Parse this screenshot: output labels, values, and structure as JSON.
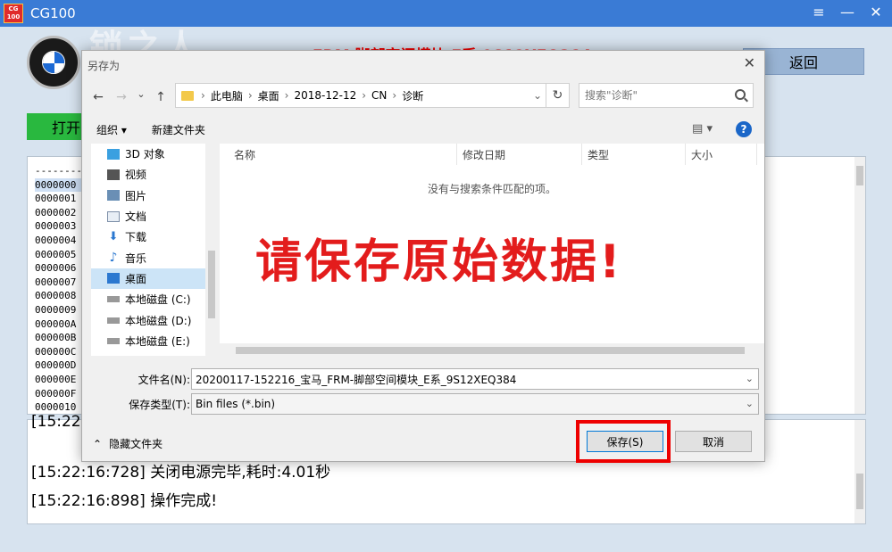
{
  "app": {
    "title": "CG100",
    "logo_text_top": "CG",
    "logo_text_bottom": "100",
    "window_controls": [
      "≡",
      "—",
      "✕"
    ],
    "watermark": "锁之人",
    "header_red_text": "FRM 脚部空间模块 E系 9S12XEQ384",
    "back_label": "返回",
    "open_label": "打开"
  },
  "hex_list": {
    "top_dashes": "--------",
    "rows": [
      "0000000",
      "0000001",
      "0000002",
      "0000003",
      "0000004",
      "0000005",
      "0000006",
      "0000007",
      "0000008",
      "0000009",
      "000000A",
      "000000B",
      "000000C",
      "000000D",
      "000000E",
      "000000F",
      "0000010"
    ]
  },
  "log": {
    "lines": [
      "[15:22:16:728]  关闭电源完毕,耗时:4.01秒",
      "[15:22:16:898]  操作完成!"
    ],
    "partial_line": "[15:22:"
  },
  "dialog": {
    "title": "另存为",
    "close_symbol": "✕",
    "nav": {
      "back": "←",
      "forward": "→",
      "history": "⌄",
      "up": "↑"
    },
    "breadcrumb": [
      "此电脑",
      "桌面",
      "2018-12-12",
      "CN",
      "诊断"
    ],
    "refresh_symbol": "↻",
    "search_placeholder": "搜索\"诊断\"",
    "toolbar": {
      "organize": "组织 ▾",
      "new_folder": "新建文件夹",
      "view": "▤ ▾",
      "help": "?"
    },
    "nav_items": [
      {
        "label": "3D 对象",
        "icon": "3d-objects-icon",
        "color": "#3aa0e0"
      },
      {
        "label": "视频",
        "icon": "video-icon",
        "color": "#555555"
      },
      {
        "label": "图片",
        "icon": "pictures-icon",
        "color": "#6a8fb5"
      },
      {
        "label": "文档",
        "icon": "documents-icon",
        "color": "#7d8fa8"
      },
      {
        "label": "下载",
        "icon": "downloads-icon",
        "color": "#2b78d0"
      },
      {
        "label": "音乐",
        "icon": "music-icon",
        "color": "#2b78d0"
      },
      {
        "label": "桌面",
        "icon": "desktop-icon",
        "color": "#2b78d0"
      },
      {
        "label": "本地磁盘 (C:)",
        "icon": "drive-icon",
        "color": "#777777"
      },
      {
        "label": "本地磁盘 (D:)",
        "icon": "drive-icon",
        "color": "#777777"
      },
      {
        "label": "本地磁盘 (E:)",
        "icon": "drive-icon",
        "color": "#777777"
      }
    ],
    "columns": [
      "名称",
      "修改日期",
      "类型",
      "大小"
    ],
    "empty_message": "没有与搜索条件匹配的项。",
    "overlay_text": "请保存原始数据!",
    "filename_label": "文件名(N):",
    "filename_value": "20200117-152216_宝马_FRM-脚部空间模块_E系_9S12XEQ384",
    "filetype_label": "保存类型(T):",
    "filetype_value": "Bin files (*.bin)",
    "hide_folders": "隐藏文件夹",
    "save_label": "保存(S)",
    "cancel_label": "取消"
  },
  "colors": {
    "accent": "#3a7bd5",
    "warning_red": "#e31c1c",
    "open_green": "#29b83f"
  }
}
